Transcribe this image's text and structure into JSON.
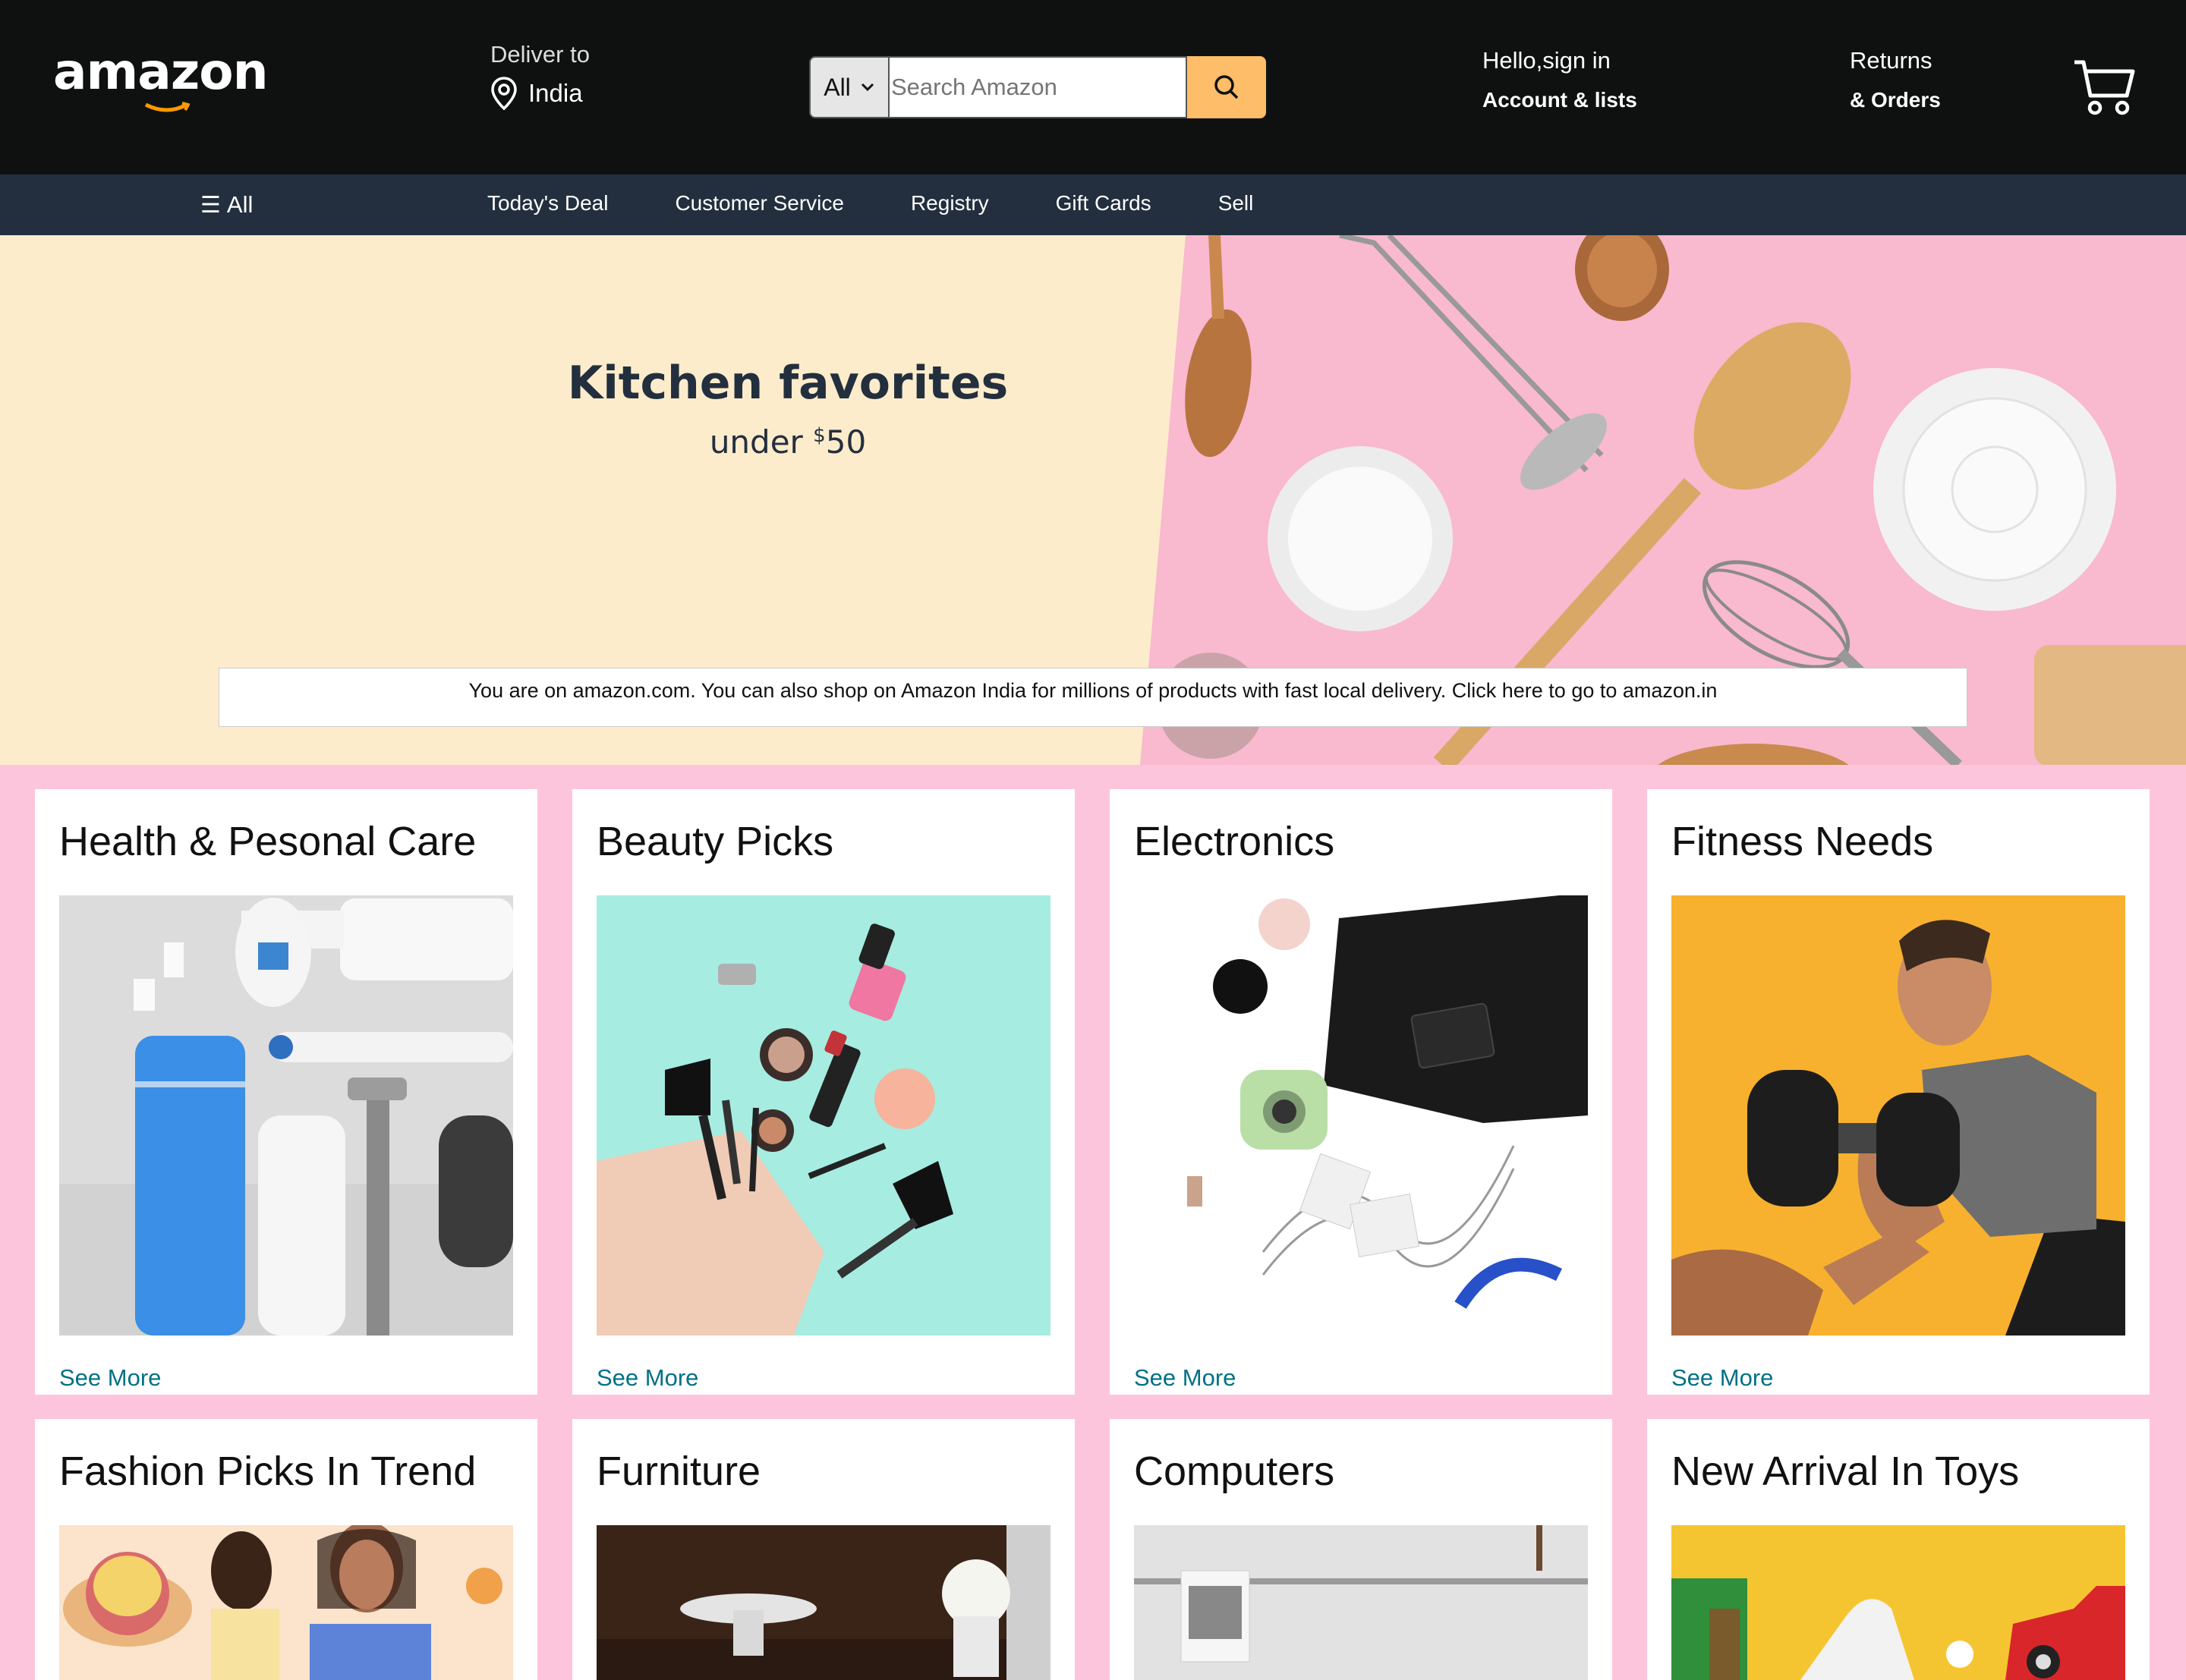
{
  "header": {
    "logo_text": "amazon",
    "deliver_label": "Deliver to",
    "deliver_country": "India",
    "search": {
      "category": "All",
      "placeholder": "Search Amazon"
    },
    "signin_top": "Hello,sign in",
    "signin_bottom": "Account & lists",
    "returns_top": "Returns",
    "returns_bottom": "& Orders",
    "icons": [
      "location-pin-icon",
      "search-icon",
      "cart-icon"
    ]
  },
  "nav": {
    "all_label": "All",
    "links": [
      "Today's Deal",
      "Customer Service",
      "Registry",
      "Gift Cards",
      "Sell"
    ]
  },
  "hero": {
    "title": "Kitchen favorites",
    "subtitle_prefix": "under ",
    "subtitle_currency": "$",
    "subtitle_amount": "50",
    "notice": "You are on amazon.com. You can also shop on Amazon India for millions of products with fast local delivery. Click here to go to amazon.in"
  },
  "cards": [
    {
      "title": "Health & Pesonal Care",
      "link": "See More"
    },
    {
      "title": "Beauty Picks",
      "link": "See More"
    },
    {
      "title": "Electronics",
      "link": "See More"
    },
    {
      "title": "Fitness Needs",
      "link": "See More"
    },
    {
      "title": "Fashion Picks In Trend"
    },
    {
      "title": "Furniture"
    },
    {
      "title": "Computers"
    },
    {
      "title": "New Arrival In Toys"
    }
  ],
  "colors": {
    "header_bg": "#0f1111",
    "nav_bg": "#232f3e",
    "search_button": "#febd69",
    "page_bg": "#fdc5db",
    "hero_left": "#fdeccb",
    "link": "#007185"
  }
}
